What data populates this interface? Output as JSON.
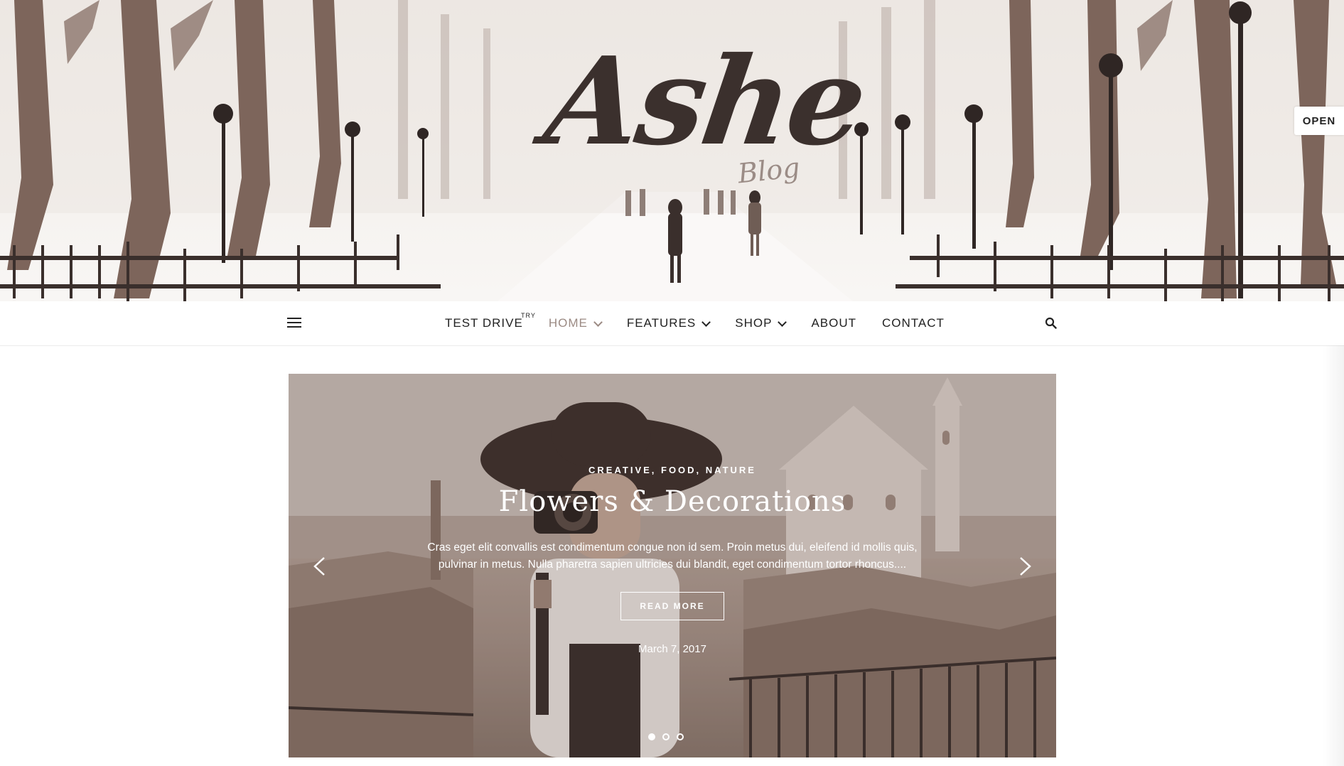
{
  "header": {
    "logo_title": "Ashe",
    "logo_subtitle": "Blog",
    "open_tab_label": "OPEN"
  },
  "nav": {
    "menu_icon": "hamburger-icon",
    "items": [
      {
        "label": "TEST DRIVE",
        "badge": "TRY",
        "dropdown": false,
        "active": false
      },
      {
        "label": "HOME",
        "dropdown": true,
        "active": true
      },
      {
        "label": "FEATURES",
        "dropdown": true,
        "active": false
      },
      {
        "label": "SHOP",
        "dropdown": true,
        "active": false
      },
      {
        "label": "ABOUT",
        "dropdown": false,
        "active": false
      },
      {
        "label": "CONTACT",
        "dropdown": false,
        "active": false
      }
    ],
    "search_icon": "search-icon",
    "active_color": "#9b8a83"
  },
  "slider": {
    "categories": "CREATIVE, FOOD, NATURE",
    "title": "Flowers & Decorations",
    "excerpt": "Cras eget elit convallis est condimentum congue non id sem. Proin metus dui, eleifend id mollis quis, pulvinar in metus. Nulla pharetra sapien ultricies dui blandit, eget condimentum tortor rhoncus....",
    "read_more_label": "READ MORE",
    "date": "March 7, 2017",
    "dots_count": 3,
    "active_dot": 0
  },
  "colors": {
    "logo": "#3b302d",
    "text": "#222222"
  }
}
